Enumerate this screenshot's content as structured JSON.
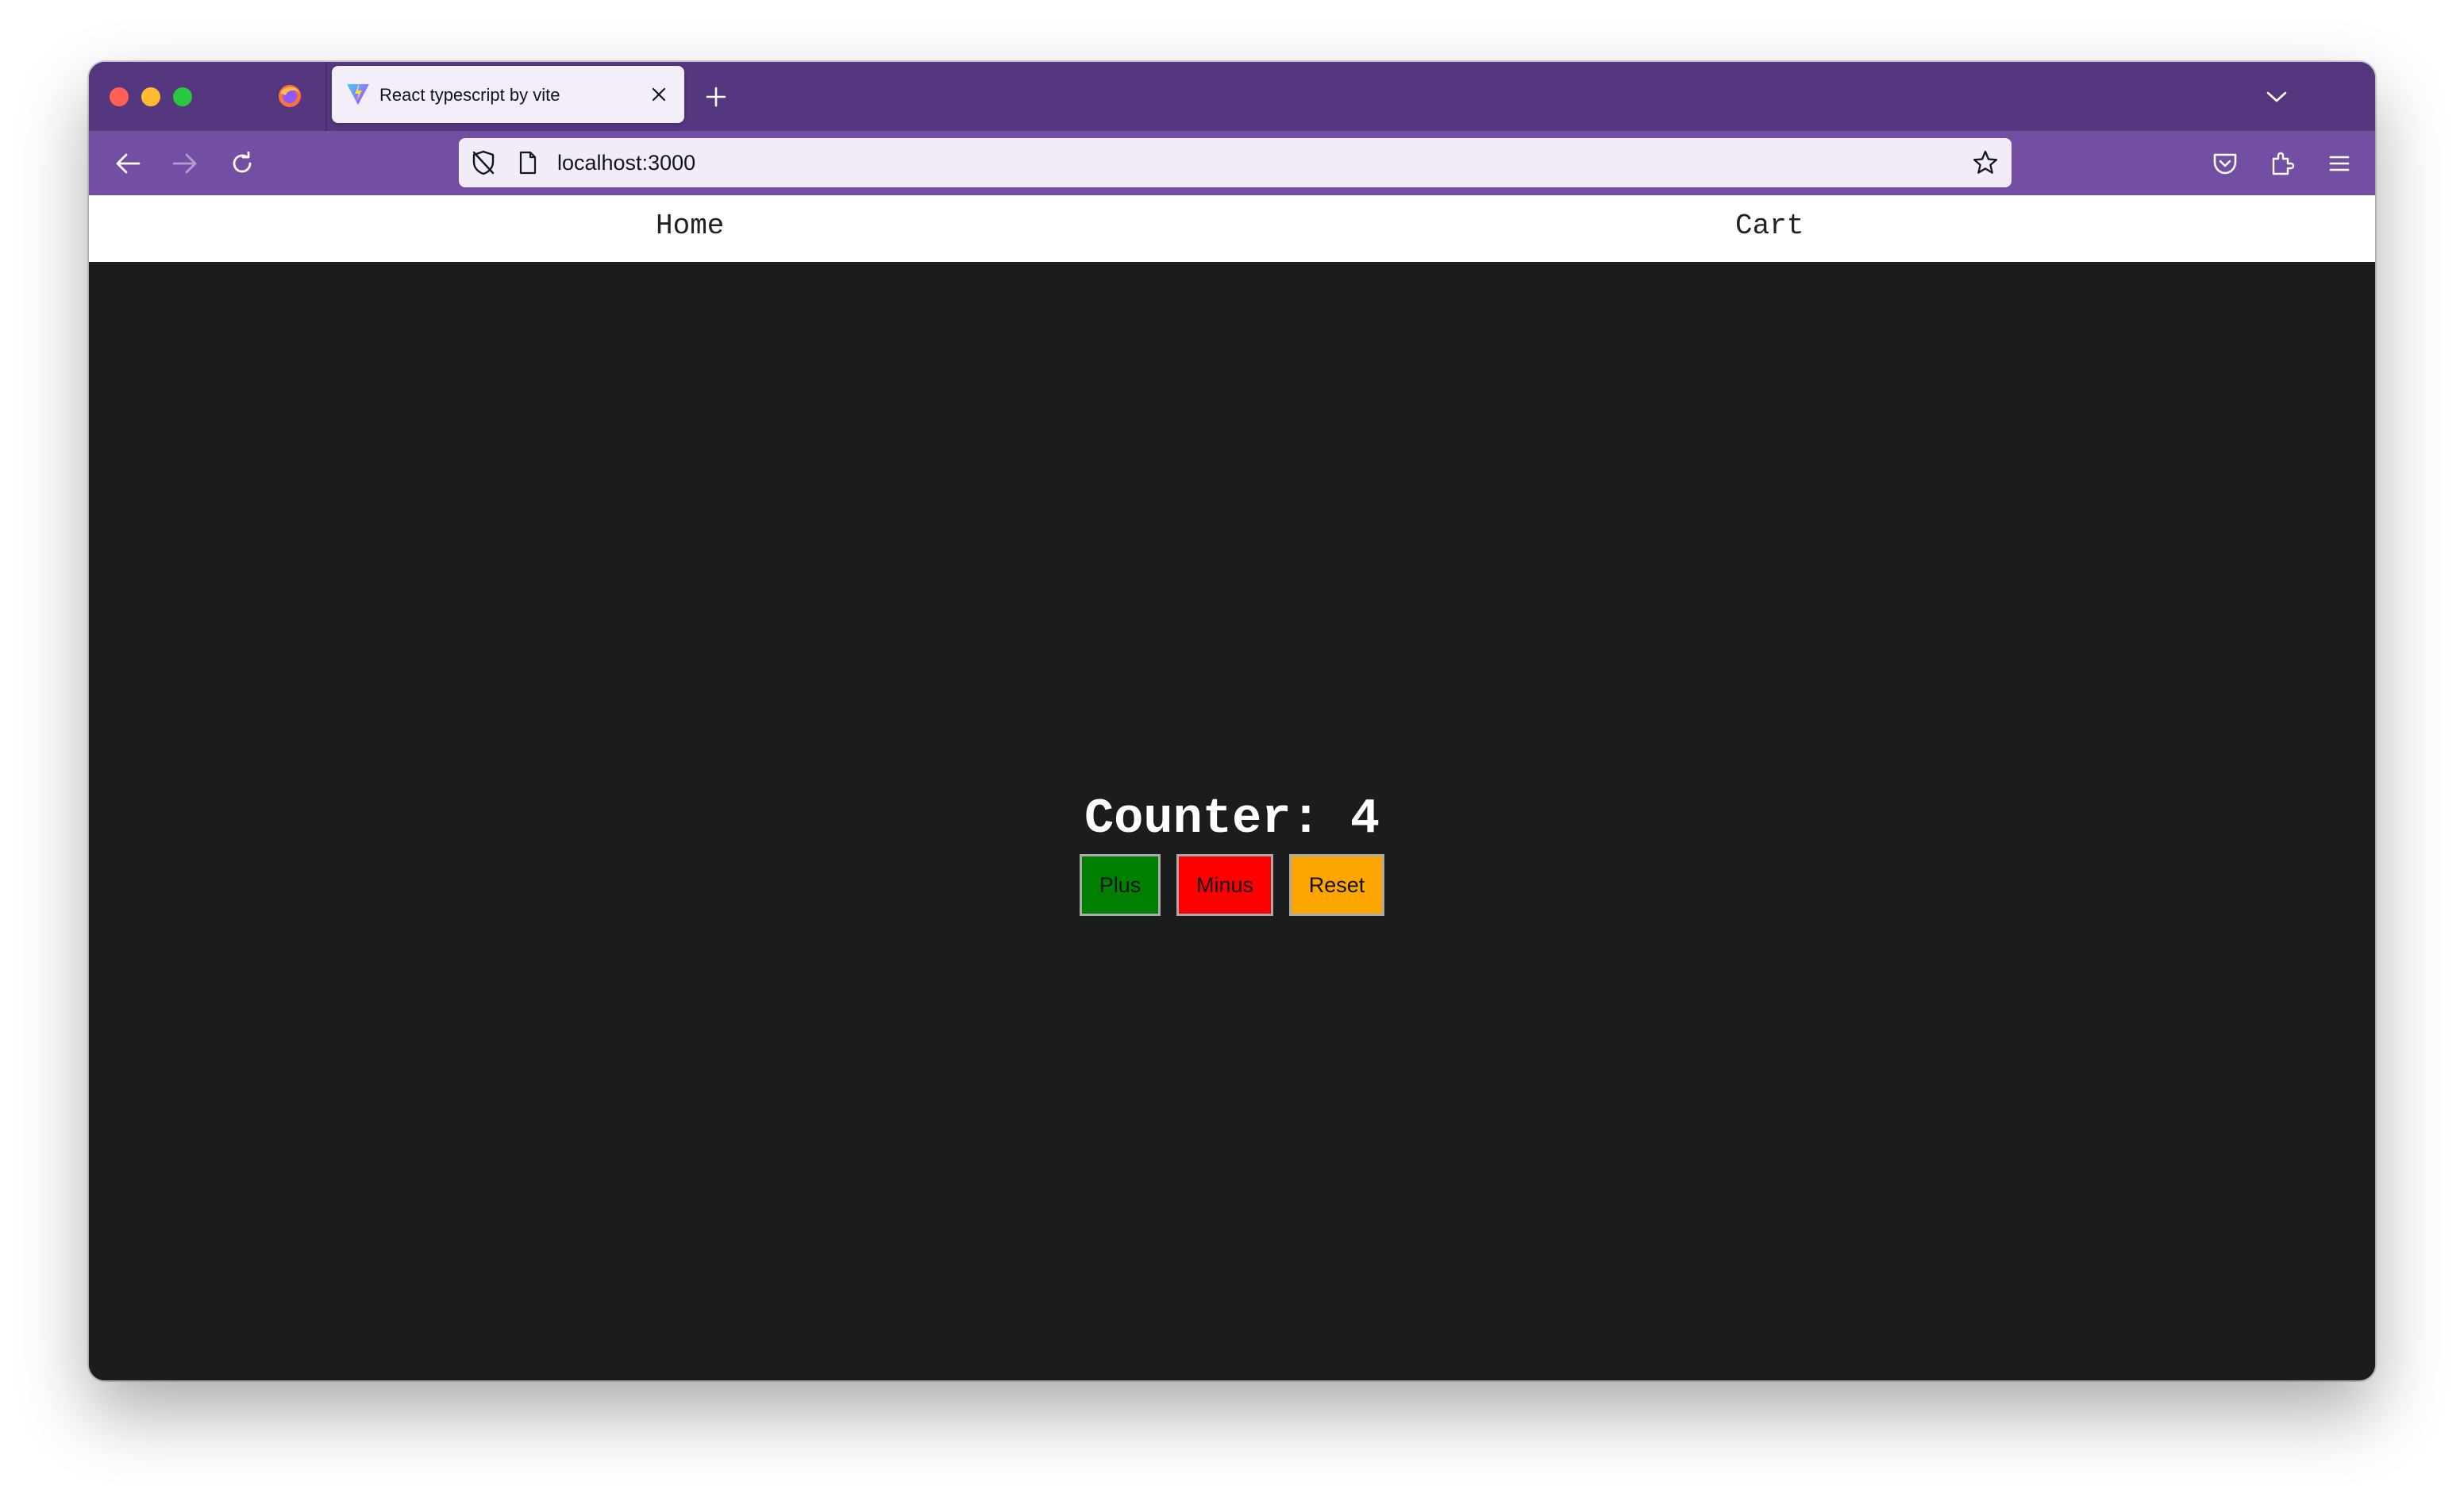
{
  "browser": {
    "tab": {
      "title": "React typescript by vite",
      "favicon": "vite-logo-icon"
    },
    "url": "localhost:3000",
    "icons": {
      "app": "firefox-logo-icon",
      "tab_close": "close-icon",
      "new_tab": "plus-icon",
      "list_tabs": "chevron-down-icon",
      "back": "back-arrow-icon",
      "forward": "forward-arrow-icon",
      "reload": "reload-icon",
      "tracking": "shield-icon",
      "page": "page-icon",
      "bookmark": "star-icon",
      "pocket": "pocket-icon",
      "extensions": "puzzle-icon",
      "menu": "hamburger-menu-icon"
    },
    "colors": {
      "tabstrip": "#55377f",
      "navbar": "#724fa3",
      "urlbar": "#f1ecf6"
    }
  },
  "site": {
    "nav": {
      "home_label": "Home",
      "cart_label": "Cart"
    },
    "counter": {
      "text": "Counter: 4",
      "value": 4
    },
    "buttons": [
      {
        "label": "Plus",
        "color": "#008000"
      },
      {
        "label": "Minus",
        "color": "#ff0000"
      },
      {
        "label": "Reset",
        "color": "#ffa500"
      }
    ],
    "colors": {
      "page_background": "#1b1c1e",
      "nav_background": "#ffffff"
    }
  }
}
